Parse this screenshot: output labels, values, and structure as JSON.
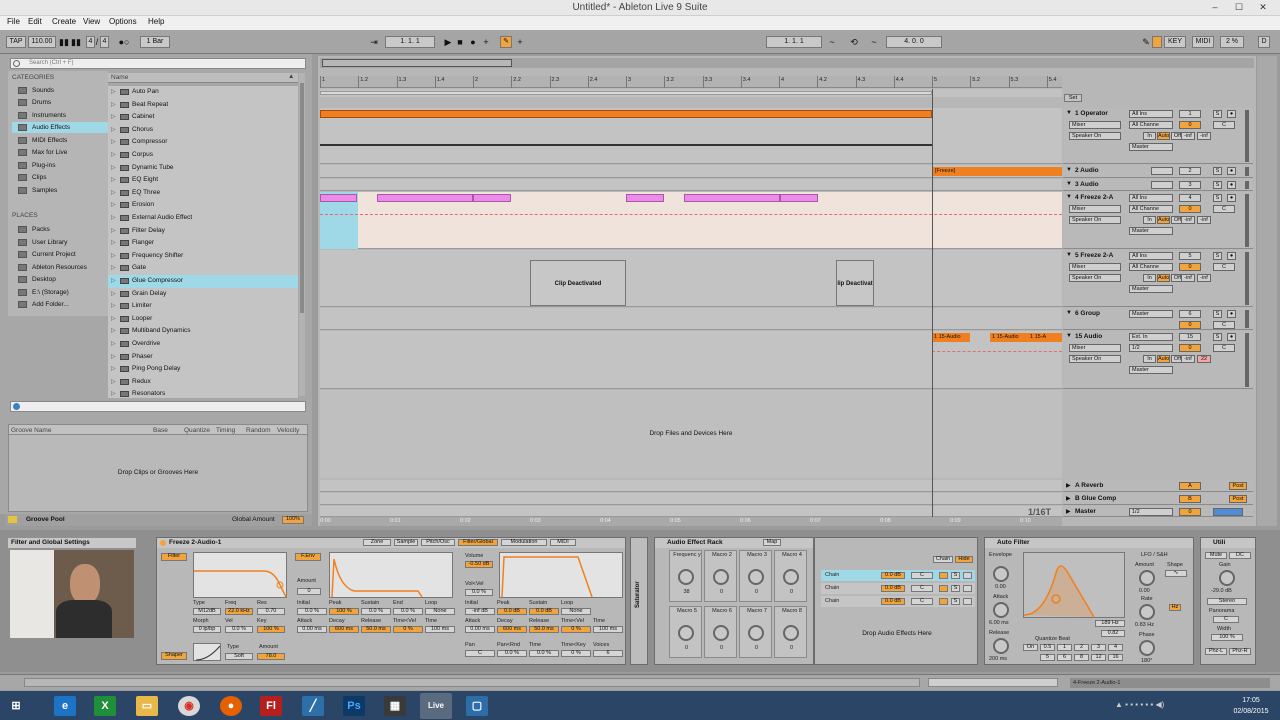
{
  "window": {
    "title": "Untitled* - Ableton Live 9 Suite",
    "minimize": "–",
    "maximize": "☐",
    "close": "✕"
  },
  "menu": [
    "File",
    "Edit",
    "Create",
    "View",
    "Options",
    "Help"
  ],
  "transport": {
    "tap": "TAP",
    "tempo": "110.00",
    "sig_num": "4",
    "sig_den": "4",
    "quantize": "1 Bar",
    "position": "1.  1.  1",
    "loop_start": "1.  1.  1",
    "loop_length": "4.  0.  0",
    "key": "KEY",
    "midi": "MIDI",
    "cpu": "2 %",
    "d": "D"
  },
  "browser": {
    "search_placeholder": "Search (Ctrl + F)",
    "categories_header": "CATEGORIES",
    "categories": [
      "Sounds",
      "Drums",
      "Instruments",
      "Audio Effects",
      "MIDI Effects",
      "Max for Live",
      "Plug-ins",
      "Clips",
      "Samples"
    ],
    "places_header": "PLACES",
    "places": [
      "Packs",
      "User Library",
      "Current Project",
      "Ableton Resources",
      "Desktop",
      "E:\\ (Storage)",
      "Add Folder..."
    ],
    "name_header": "Name",
    "names": [
      "Auto Pan",
      "Beat Repeat",
      "Cabinet",
      "Chorus",
      "Compressor",
      "Corpus",
      "Dynamic Tube",
      "EQ Eight",
      "EQ Three",
      "Erosion",
      "External Audio Effect",
      "Filter Delay",
      "Flanger",
      "Frequency Shifter",
      "Gate",
      "Glue Compressor",
      "Grain Delay",
      "Limiter",
      "Looper",
      "Multiband Dynamics",
      "Overdrive",
      "Phaser",
      "Ping Pong Delay",
      "Redux",
      "Resonators"
    ],
    "selected_name": "Glue Compressor"
  },
  "groove": {
    "columns": [
      "Groove Name",
      "Base",
      "Quantize",
      "Timing",
      "Random",
      "Velocity"
    ],
    "drop_hint": "Drop Clips or Grooves Here",
    "pool_label": "Groove Pool",
    "global_amount_label": "Global Amount",
    "global_amount": "100%"
  },
  "arrangement": {
    "ruler": [
      "1",
      "1.2",
      "1.3",
      "1.4",
      "2",
      "2.2",
      "2.3",
      "2.4",
      "3",
      "3.2",
      "3.3",
      "3.4",
      "4",
      "4.2",
      "4.3",
      "4.4",
      "5",
      "5.2",
      "5.3",
      "5.4"
    ],
    "time_ruler": [
      "0:00",
      "0:01",
      "0:02",
      "0:03",
      "0:04",
      "0:05",
      "0:06",
      "0:07",
      "0:08",
      "0:09",
      "0:10"
    ],
    "set_label": "Set",
    "clip_deactivated": "Clip Deactivated",
    "clip_deactivated_partial": "lip Deactivat",
    "freeze_clip": "[Freeze]",
    "audio_clip": "1 15-Audio",
    "audio_clip_b": "1 15-Audio",
    "audio_clip_c": "1 15-A",
    "drop_hint": "Drop Files and Devices Here",
    "zoom": "1/16T"
  },
  "tracks": [
    {
      "name": "1 Operator",
      "input": "All Ins",
      "channel": "All Channe",
      "monitor": [
        "In",
        "Auto",
        "Off"
      ],
      "output": "Master",
      "num": "1",
      "vol": "0",
      "pan": "C"
    },
    {
      "name": "2 Audio",
      "num": "2"
    },
    {
      "name": "3 Audio",
      "num": "3"
    },
    {
      "name": "4 Freeze 2-A",
      "input": "All Ins",
      "channel": "All Channe",
      "monitor": [
        "In",
        "Auto",
        "Off"
      ],
      "output": "Master",
      "num": "4",
      "vol": "0",
      "pan": "C"
    },
    {
      "name": "5 Freeze 2-A",
      "input": "All Ins",
      "channel": "All Channe",
      "monitor": [
        "In",
        "Auto",
        "Off"
      ],
      "output": "Master",
      "num": "5",
      "vol": "0",
      "pan": "C"
    },
    {
      "name": "6 Group",
      "output": "Master",
      "num": "6",
      "vol": "0",
      "pan": "C"
    },
    {
      "name": "15 Audio",
      "input": "Ext. In",
      "channel": "1/2",
      "monitor": [
        "In",
        "Auto",
        "Off"
      ],
      "output": "Master",
      "num": "15",
      "vol": "0",
      "pan": "C",
      "extra": "22"
    }
  ],
  "returns": [
    {
      "name": "A Reverb",
      "letter": "A",
      "post": "Post"
    },
    {
      "name": "B Glue Comp",
      "letter": "B",
      "post": "Post"
    },
    {
      "name": "Master",
      "route": "1/2",
      "num": "0"
    }
  ],
  "mixer_labels": {
    "mixer": "Mixer",
    "speaker_on": "Speaker On",
    "inf": "-inf",
    "s": "S"
  },
  "detail": {
    "info_title": "Filter and Global Settings",
    "sampler": {
      "title": "Freeze 2-Audio-1",
      "tabs": [
        "Zone",
        "Sample",
        "Pitch/Osc",
        "Filter/Global",
        "Modulation",
        "MIDI"
      ],
      "filter_label": "Filter",
      "fenv_label": "F.Env",
      "type_label": "Type",
      "type": "M12dB",
      "freq_label": "Freq",
      "freq": "22.0 kHz",
      "res_label": "Res",
      "res": "0.70",
      "morph_label": "Morph",
      "morph": "0 lp/bp",
      "vel_label": "Vel",
      "vel": "0.0 %",
      "key_label": "Key",
      "key": "100 %",
      "amount_label": "Amount",
      "amount": "0",
      "env_labels": [
        "Initial",
        "Peak",
        "Sustain",
        "End",
        "Loop"
      ],
      "env_values": [
        "0.0 %",
        "100 %",
        "0.0 %",
        "0.0 %",
        "None"
      ],
      "env_labels2": [
        "Attack",
        "Decay",
        "Release",
        "Time<Vel",
        "Time"
      ],
      "env_values2": [
        "0.00 ms",
        "600 ms",
        "50.0 ms",
        "0 %",
        "100 ms"
      ],
      "shaper_label": "Shaper",
      "shaper_type_label": "Type",
      "shaper_type": "Soft",
      "shaper_amount_label": "Amount",
      "shaper_amount": "78.0",
      "volume_label": "Volume",
      "volume": "-0.50 dB",
      "volvel_label": "Vol<Vel",
      "volvel": "0.0 %",
      "amp_labels": [
        "Initial",
        "Peak",
        "Sustain",
        "Loop"
      ],
      "amp_values": [
        "-inf dB",
        "0.0 dB",
        "0.0 dB",
        "None"
      ],
      "amp_labels2": [
        "Attack",
        "Decay",
        "Release",
        "Time<Vel",
        "Time"
      ],
      "amp_values2": [
        "0.00 ms",
        "600 ms",
        "50.0 ms",
        "0 %",
        "100 ms"
      ],
      "pan_labels": [
        "Pan",
        "Pan<Rnd",
        "Time",
        "Time<Key",
        "Voices"
      ],
      "pan_values": [
        "C",
        "0.0 %",
        "0.0 %",
        "0 %",
        "6"
      ],
      "saturator_label": "Saturator"
    },
    "rack": {
      "title": "Audio Effect Rack",
      "map": "Map",
      "macros": [
        "Frequenc y",
        "Macro 2",
        "Macro 3",
        "Macro 4",
        "Macro 5",
        "Macro 6",
        "Macro 7",
        "Macro 8"
      ],
      "macro_values": [
        "38",
        "0",
        "0",
        "0",
        "0",
        "0",
        "0",
        "0"
      ],
      "chain_header": "Chain",
      "hide": "Hide",
      "chains": [
        "Chain",
        "Chain",
        "Chain"
      ],
      "chain_db": "0.0 dB",
      "chain_pan": "C",
      "drop_hint": "Drop Audio Effects Here"
    },
    "autofilter": {
      "title": "Auto Filter",
      "envelope_label": "Envelope",
      "env_value": "0.00",
      "attack_label": "Attack",
      "attack": "6.00 ms",
      "release_label": "Release",
      "release": "200 ms",
      "lfo_label": "LFO / S&H",
      "amount_label": "Amount",
      "amount": "0.00",
      "shape_label": "Shape",
      "rate_label": "Rate",
      "rate": "0.83 Hz",
      "hz": "Hz",
      "phase_label": "Phase",
      "phase": "180°",
      "freq": "189 Hz",
      "q": "0.82",
      "quantize_label": "Quantize Beat",
      "quantize_row1": [
        "On",
        "0.5",
        "1",
        "2",
        "3",
        "4"
      ],
      "quantize_row2": [
        "5",
        "6",
        "8",
        "12",
        "16"
      ]
    },
    "utility": {
      "title": "Utili",
      "mute": "Mute",
      "dc": "DC",
      "gain_label": "Gain",
      "gain": "-29.0 dB",
      "stereo": "Stereo",
      "panorama_label": "Panorama",
      "pan": "C",
      "width_label": "Width",
      "width": "100 %",
      "phz_l": "Phz-L",
      "phz_r": "Phz-R"
    }
  },
  "statusbar": {
    "right_text": "4-Freeze 2-Audio-1"
  },
  "taskbar": {
    "time": "17:05",
    "date": "02/08/2015",
    "live": "Live"
  },
  "colors": {
    "orange": "#f0801f",
    "pink": "#ee8bea",
    "cyan": "#9fd9e7",
    "selected_orange": "#f1a33c"
  }
}
